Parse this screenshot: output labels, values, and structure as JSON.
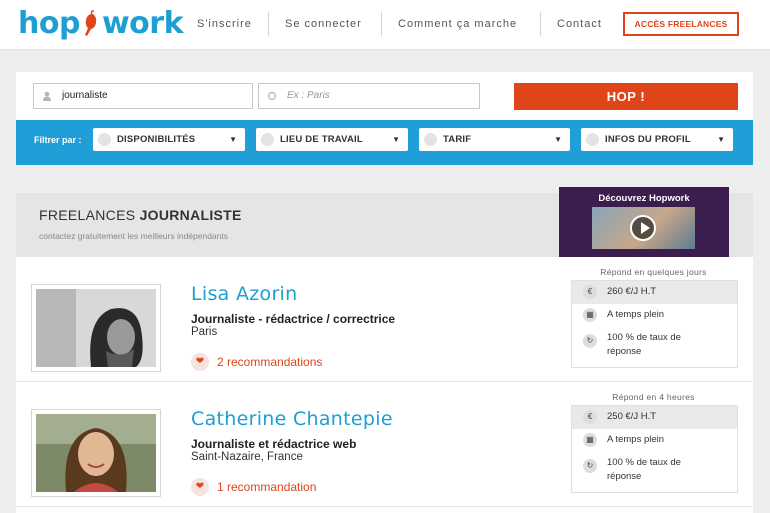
{
  "header": {
    "logo_left": "hop",
    "logo_right": "work",
    "nav": [
      "S'inscrire",
      "Se connecter",
      "Comment ça marche",
      "Contact"
    ],
    "cta_label": "ACCÈS FREELANCES"
  },
  "search": {
    "query_value": "journaliste",
    "location_placeholder": "Ex : Paris",
    "submit_label": "HOP !"
  },
  "filters": {
    "label": "Filtrer par :",
    "options": [
      "DISPONIBILITÉS",
      "LIEU DE TRAVAIL",
      "TARIF",
      "INFOS DU PROFIL"
    ]
  },
  "results": {
    "title_prefix": "FREELANCES",
    "title_keyword": "JOURNALISTE",
    "subtitle": "contactez gratuitement les meilleurs indépendants",
    "video_title": "Découvrez Hopwork"
  },
  "freelancers": [
    {
      "name": "Lisa Azorin",
      "job": "Journaliste - rédactrice / correctrice",
      "location": "Paris",
      "recommendations": "2 recommandations",
      "response_time": "Répond en quelques jours",
      "rate": "260 €/J H.T",
      "availability": "A temps plein",
      "response_rate_line1": "100 % de taux de",
      "response_rate_line2": "réponse"
    },
    {
      "name": "Catherine Chantepie",
      "job": "Journaliste et rédactrice web",
      "location": "Saint-Nazaire, France",
      "recommendations": "1 recommandation",
      "response_time": "Répond en 4 heures",
      "rate": "250 €/J H.T",
      "availability": "A temps plein",
      "response_rate_line1": "100 % de taux de",
      "response_rate_line2": "réponse"
    }
  ],
  "colors": {
    "brand_blue": "#1d9fd3",
    "accent_orange": "#e0451a",
    "filter_bar": "#209ed8",
    "video_bg": "#3b1d4e"
  }
}
